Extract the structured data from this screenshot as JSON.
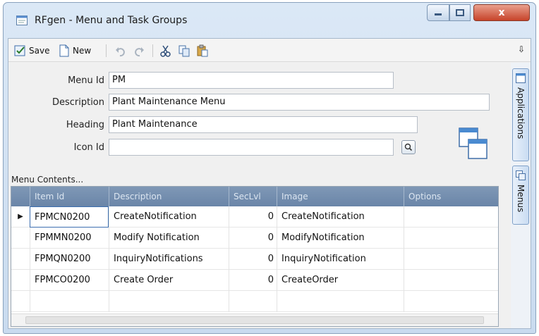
{
  "window": {
    "title": "RFgen - Menu and Task Groups",
    "close_glyph": "x",
    "accent_color": "#6a85a8"
  },
  "toolbar": {
    "save_label": "Save",
    "new_label": "New",
    "pin_glyph": "⇩",
    "icons": [
      "save-icon",
      "new-icon",
      "undo-icon",
      "redo-icon",
      "cut-icon",
      "copy-icon",
      "paste-icon",
      "pin-icon"
    ]
  },
  "side_tabs": {
    "applications_label": "Applications",
    "menus_label": "Menus"
  },
  "form": {
    "menu_id_label": "Menu Id",
    "menu_id_value": "PM",
    "description_label": "Description",
    "description_value": "Plant Maintenance Menu",
    "heading_label": "Heading",
    "heading_value": "Plant Maintenance",
    "icon_id_label": "Icon Id",
    "icon_id_value": ""
  },
  "menu_contents": {
    "label": "Menu Contents...",
    "columns": [
      "Item Id",
      "Description",
      "SecLvl",
      "Image",
      "Options"
    ],
    "rows": [
      {
        "item_id": "FPMCN0200",
        "description": "CreateNotification",
        "seclvl": "0",
        "image": "CreateNotification",
        "options": ""
      },
      {
        "item_id": "FPMMN0200",
        "description": "Modify Notification",
        "seclvl": "0",
        "image": "ModifyNotification",
        "options": ""
      },
      {
        "item_id": "FPMQN0200",
        "description": "InquiryNotifications",
        "seclvl": "0",
        "image": "InquiryNotification",
        "options": ""
      },
      {
        "item_id": "FPMCO0200",
        "description": "Create Order",
        "seclvl": "0",
        "image": "CreateOrder",
        "options": ""
      }
    ],
    "current_row_marker": "▶"
  }
}
